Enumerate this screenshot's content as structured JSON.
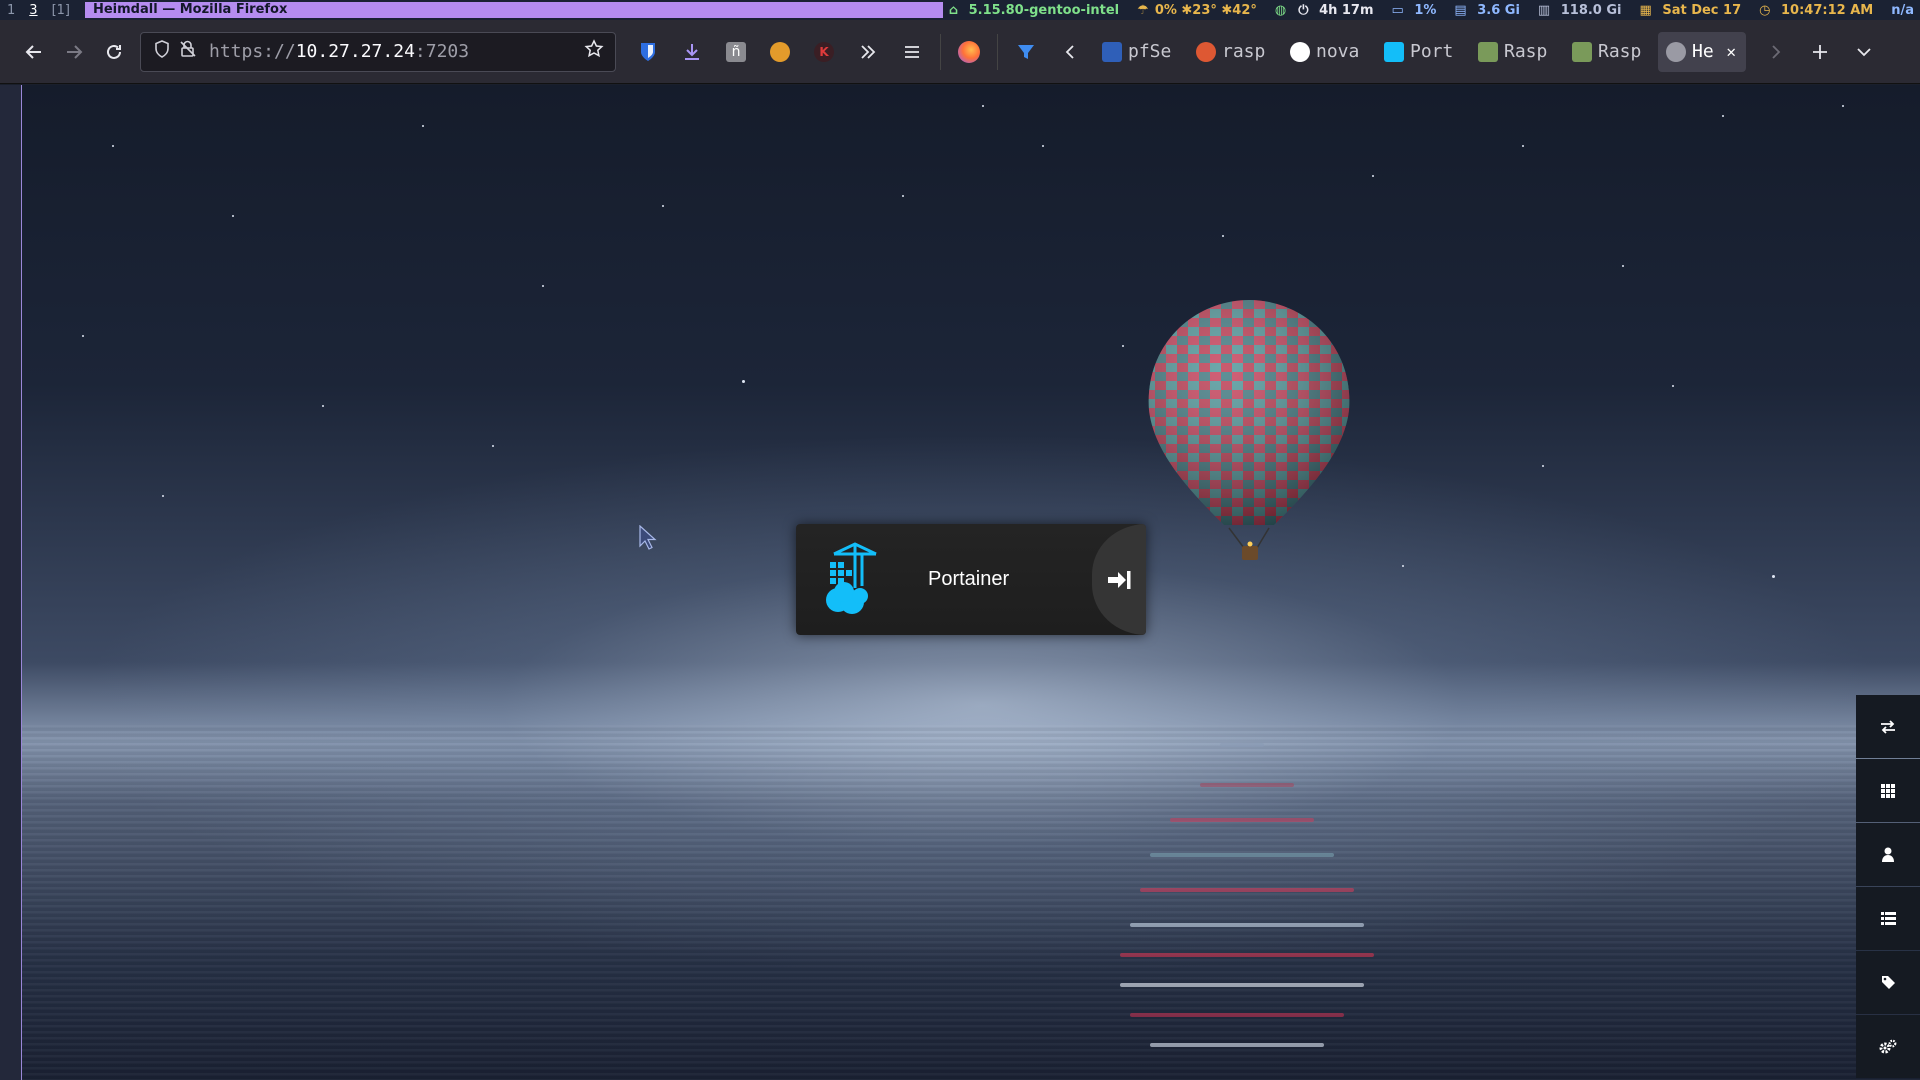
{
  "wm": {
    "workspaces": [
      "1",
      "3",
      "[1]"
    ],
    "window_title": "Heimdall — Mozilla Firefox",
    "status": {
      "kernel": "5.15.80-gentoo-intel",
      "cpu_temps": "0% ✱23° ✱42°",
      "uptime": "4h 17m",
      "cpu": "1%",
      "mem": "3.6 Gi",
      "disk": "118.0 Gi",
      "date": "Sat Dec 17",
      "time": "10:47:12 AM",
      "extra": "n/a"
    },
    "colors": {
      "title_bg": "#b58cf0",
      "kernel": "#7fe08a",
      "accent": "#e8b64c"
    }
  },
  "browser": {
    "url_scheme": "https://",
    "url_host": "10.27.27.24",
    "url_port": ":7203",
    "tabs": [
      {
        "label": "pfSe",
        "favicon": "pfsense-icon",
        "color": "#2f5fb8"
      },
      {
        "label": "rasp",
        "favicon": "duckduckgo-icon",
        "color": "#de5833"
      },
      {
        "label": "nova",
        "favicon": "github-icon",
        "color": "#ffffff"
      },
      {
        "label": "Port",
        "favicon": "portainer-icon",
        "color": "#13bef9"
      },
      {
        "label": "Rasp",
        "favicon": "image-icon",
        "color": "#7a9a5a"
      },
      {
        "label": "Rasp",
        "favicon": "image-icon",
        "color": "#7a9a5a"
      },
      {
        "label": "He",
        "favicon": "heimdall-icon",
        "color": "#9a9aa4",
        "selected": true
      }
    ]
  },
  "dashboard": {
    "app_tile": {
      "title": "Portainer",
      "icon": "portainer-icon",
      "color": "#13bef9"
    },
    "dock_buttons": [
      {
        "name": "switch",
        "icon": "exchange-icon"
      },
      {
        "name": "items",
        "icon": "grid-icon"
      },
      {
        "name": "users",
        "icon": "user-icon"
      },
      {
        "name": "applications",
        "icon": "list-icon"
      },
      {
        "name": "tags",
        "icon": "tag-icon"
      },
      {
        "name": "settings",
        "icon": "cogs-icon"
      }
    ]
  }
}
